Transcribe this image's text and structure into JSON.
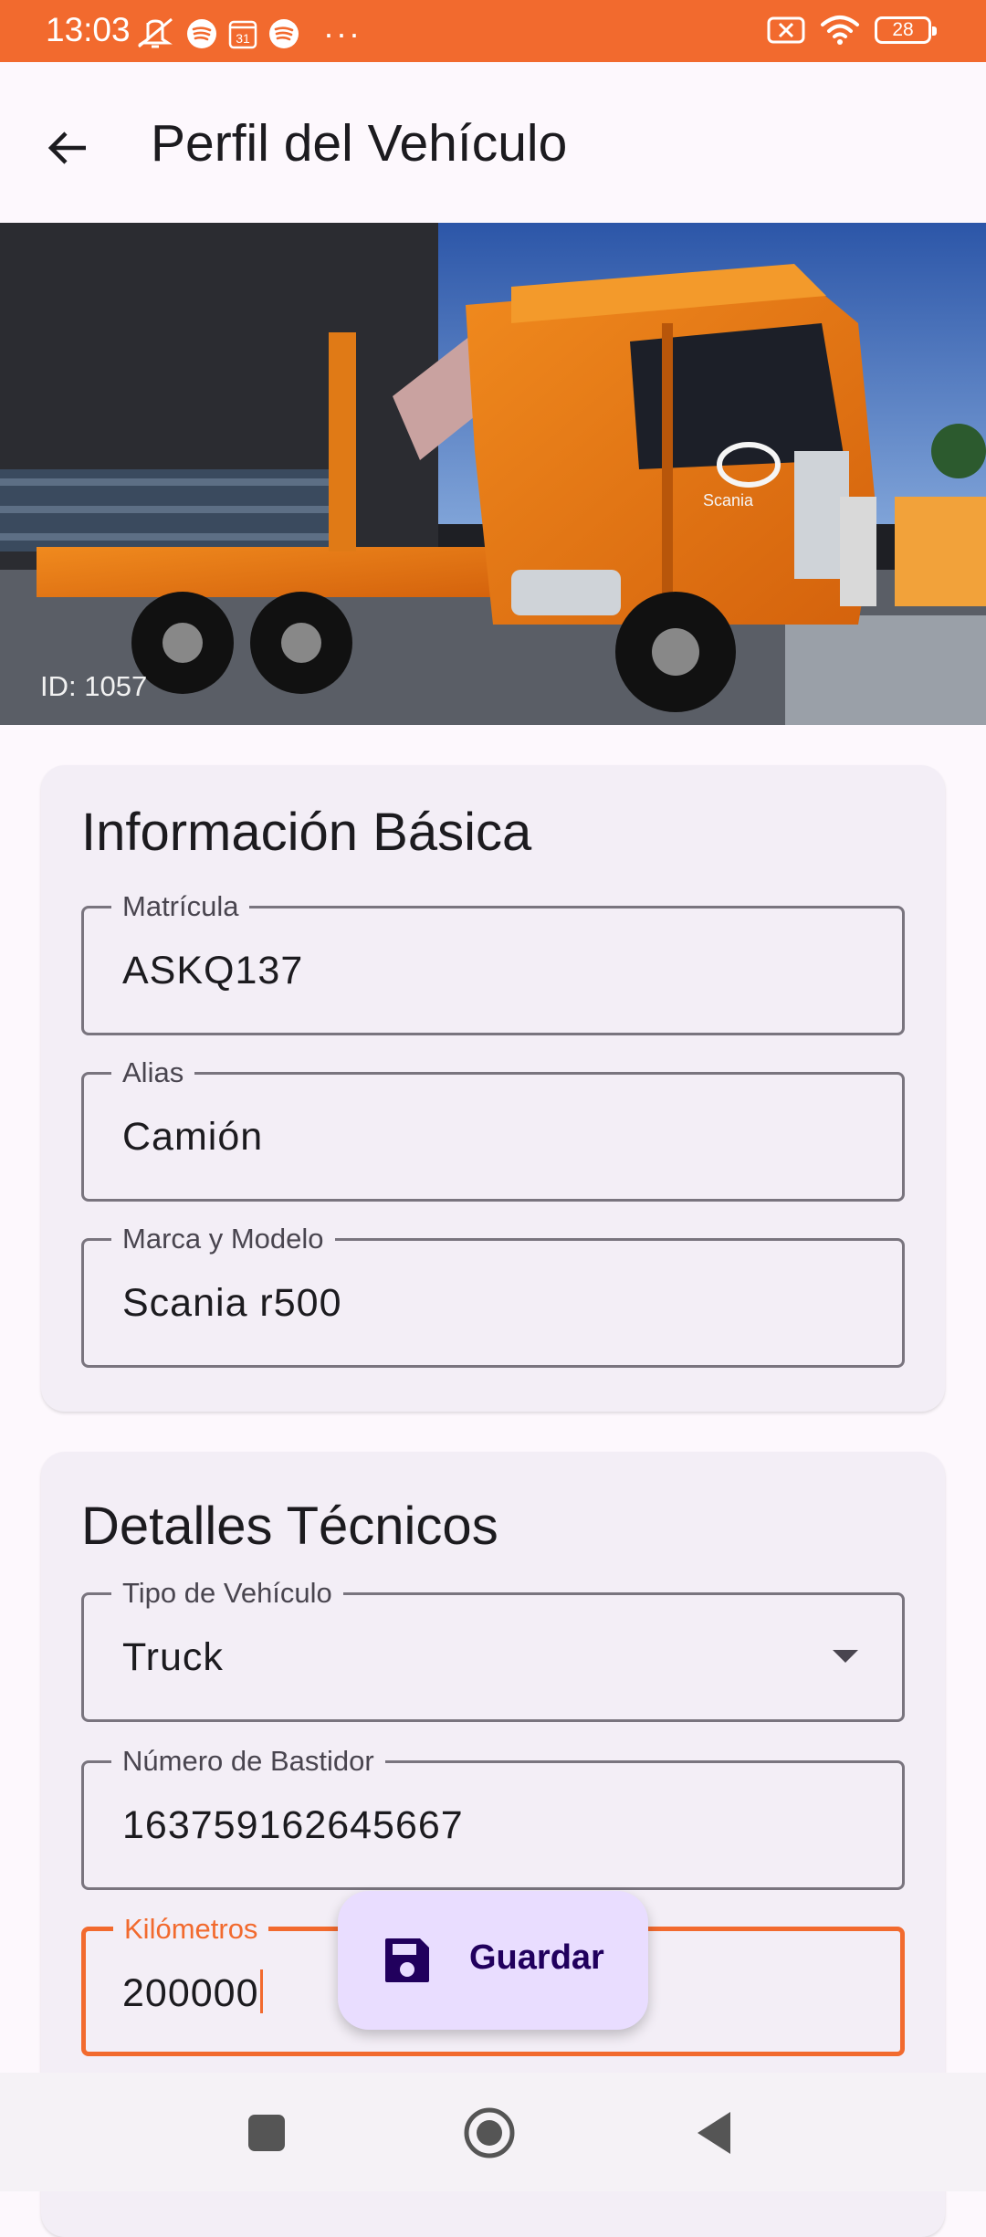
{
  "status_bar": {
    "time": "13:03",
    "left_icons": [
      "mute-notification-icon",
      "spotify-icon",
      "calendar-icon",
      "spotify-icon",
      "more-dots-icon"
    ],
    "calendar_day": "31",
    "more_dots": "···",
    "right_icons": [
      "sim-error-icon",
      "wifi-icon",
      "battery-icon"
    ],
    "battery_level": "28",
    "color": "#F26A2E"
  },
  "app_bar": {
    "back_icon": "arrow-back-icon",
    "title": "Perfil del Vehículo"
  },
  "hero": {
    "image_subject": "orange truck",
    "id_label": "ID: 1057"
  },
  "basic_info": {
    "title": "Información Básica",
    "fields": [
      {
        "label": "Matrícula",
        "value": "ASKQ137"
      },
      {
        "label": "Alias",
        "value": "Camión"
      },
      {
        "label": "Marca y Modelo",
        "value": "Scania r500"
      }
    ]
  },
  "technical": {
    "title": "Detalles Técnicos",
    "vehicle_type": {
      "label": "Tipo de Vehículo",
      "value": "Truck",
      "icon": "dropdown-arrow-icon"
    },
    "chassis": {
      "label": "Número de Bastidor",
      "value": "163759162645667"
    },
    "km": {
      "label": "Kilómetros",
      "value": "200000",
      "focused": true
    }
  },
  "fab": {
    "icon": "save-icon",
    "label": "Guardar",
    "color": "#E9DDFF"
  },
  "nav_bar": {
    "buttons": [
      "recents-square-icon",
      "home-circle-icon",
      "back-triangle-icon"
    ]
  },
  "colors": {
    "accent": "#F26A2E",
    "card_background": "#F3EEF6",
    "outline": "#79747E"
  }
}
